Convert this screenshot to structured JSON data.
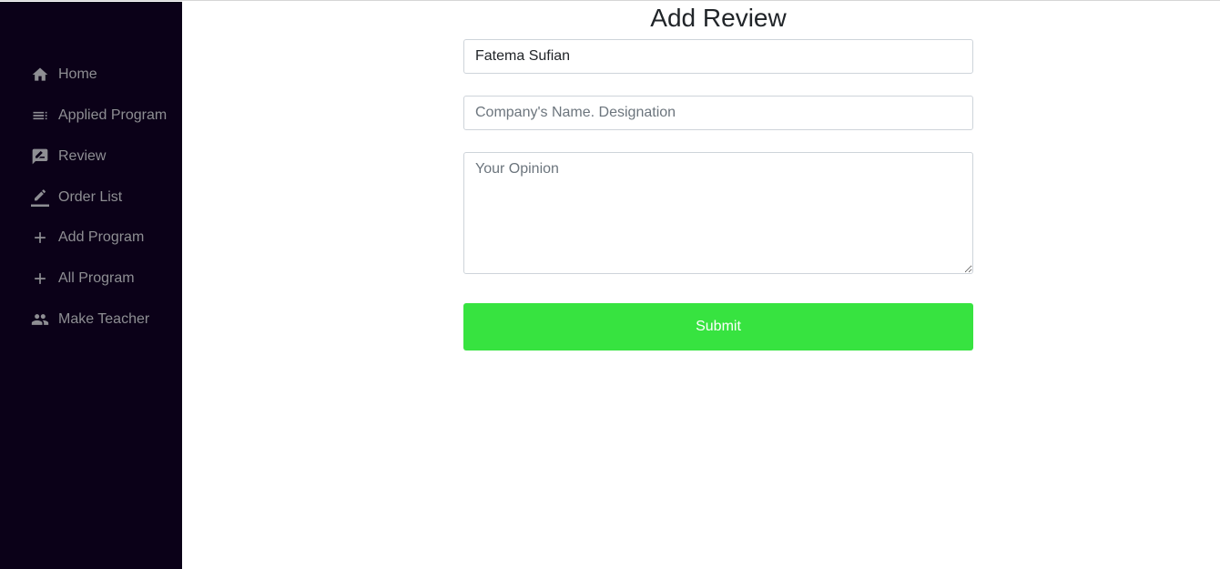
{
  "sidebar": {
    "items": [
      {
        "label": "Home",
        "icon": "home-icon"
      },
      {
        "label": "Applied Program",
        "icon": "list-icon"
      },
      {
        "label": "Review",
        "icon": "rate-review-icon"
      },
      {
        "label": "Order List",
        "icon": "edit-icon"
      },
      {
        "label": "Add Program",
        "icon": "plus-icon"
      },
      {
        "label": "All Program",
        "icon": "plus-icon"
      },
      {
        "label": "Make Teacher",
        "icon": "people-icon"
      }
    ]
  },
  "form": {
    "title": "Add Review",
    "name_value": "Fatema Sufian",
    "company_placeholder": "Company's Name. Designation",
    "opinion_placeholder": "Your Opinion",
    "submit_label": "Submit"
  },
  "colors": {
    "sidebar_bg": "#0b0118",
    "nav_text": "#8e8e93",
    "submit_bg": "#37e340"
  }
}
